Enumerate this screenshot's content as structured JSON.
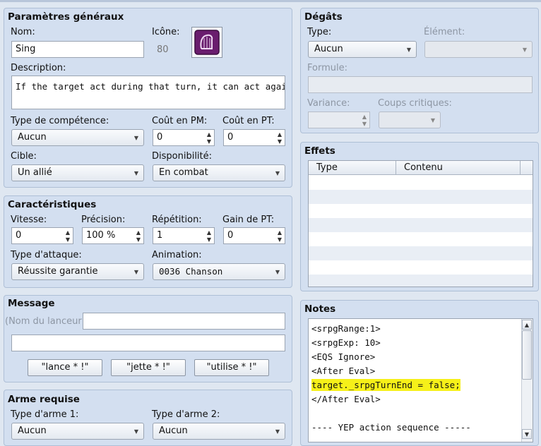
{
  "general": {
    "title": "Paramètres généraux",
    "name_label": "Nom:",
    "name_value": "Sing",
    "icon_label": "Icône:",
    "icon_index": "80",
    "description_label": "Description:",
    "description_value": "If the target act during that turn, it can act again.",
    "skill_type_label": "Type de compétence:",
    "skill_type_value": "Aucun",
    "mp_cost_label": "Coût en PM:",
    "mp_cost_value": "0",
    "tp_cost_label": "Coût en PT:",
    "tp_cost_value": "0",
    "scope_label": "Cible:",
    "scope_value": "Un allié",
    "occasion_label": "Disponibilité:",
    "occasion_value": "En combat"
  },
  "invocation": {
    "title": "Caractéristiques",
    "speed_label": "Vitesse:",
    "speed_value": "0",
    "success_label": "Précision:",
    "success_value": "100 %",
    "repeat_label": "Répétition:",
    "repeat_value": "1",
    "tp_gain_label": "Gain de PT:",
    "tp_gain_value": "0",
    "hit_type_label": "Type d'attaque:",
    "hit_type_value": "Réussite garantie",
    "animation_label": "Animation:",
    "animation_value": "0036 Chanson"
  },
  "message": {
    "title": "Message",
    "caster_placeholder": "(Nom du lanceur)",
    "line1": "",
    "line2": "",
    "btn_cast": "\"lance * !\"",
    "btn_throw": "\"jette * !\"",
    "btn_use": "\"utilise * !\""
  },
  "weapon": {
    "title": "Arme requise",
    "type1_label": "Type d'arme 1:",
    "type1_value": "Aucun",
    "type2_label": "Type d'arme 2:",
    "type2_value": "Aucun"
  },
  "damage": {
    "title": "Dégâts",
    "type_label": "Type:",
    "type_value": "Aucun",
    "element_label": "Élément:",
    "element_value": "",
    "formula_label": "Formule:",
    "formula_value": "",
    "variance_label": "Variance:",
    "variance_value": "",
    "critical_label": "Coups critiques:",
    "critical_value": ""
  },
  "effects": {
    "title": "Effets",
    "col_type": "Type",
    "col_content": "Contenu"
  },
  "notes": {
    "title": "Notes",
    "lines": [
      "<srpgRange:1>",
      "<srpgExp: 10>",
      "<EQS Ignore>",
      "<After Eval>",
      "target._srpgTurnEnd = false;",
      "</After Eval>",
      "",
      "---- YEP action sequence -----"
    ]
  },
  "colors": {
    "panel": "#d3dff0",
    "highlight": "#f6f019",
    "icon_bg": "#6a1d6e"
  },
  "icons": {
    "skill_icon": "harp-icon",
    "dropdown": "chevron-down-icon",
    "spin": "spin-arrows-icon"
  }
}
